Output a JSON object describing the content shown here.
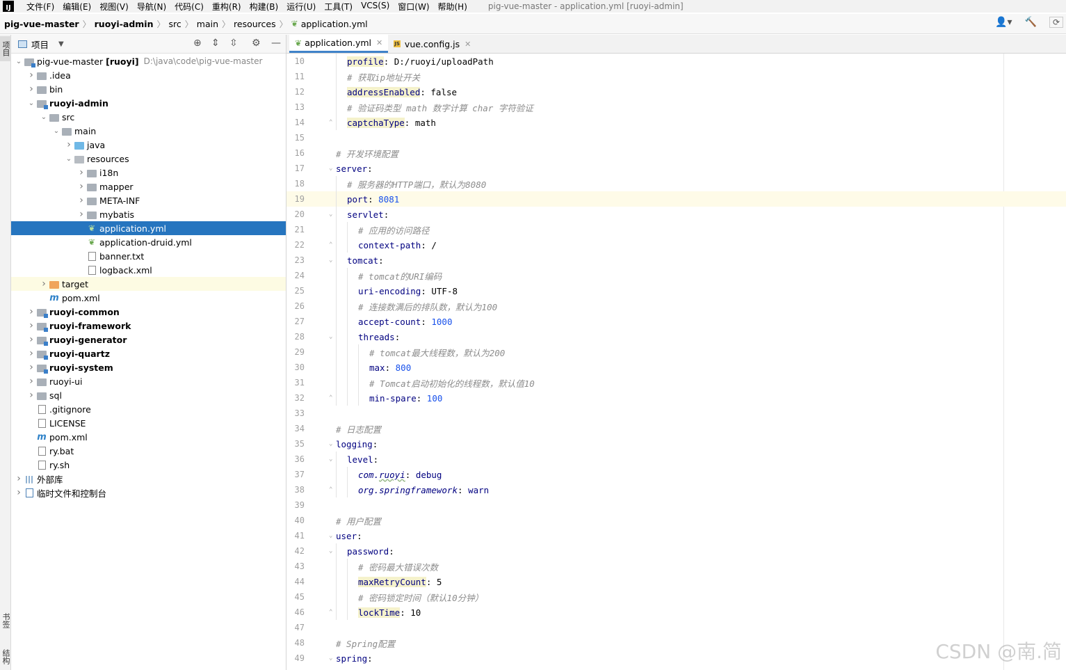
{
  "menubar": {
    "items": [
      "文件(F)",
      "编辑(E)",
      "视图(V)",
      "导航(N)",
      "代码(C)",
      "重构(R)",
      "构建(B)",
      "运行(U)",
      "工具(T)",
      "VCS(S)",
      "窗口(W)",
      "帮助(H)"
    ],
    "window_title": "pig-vue-master - application.yml [ruoyi-admin]"
  },
  "breadcrumb": [
    "pig-vue-master",
    "ruoyi-admin",
    "src",
    "main",
    "resources",
    "application.yml"
  ],
  "strip": {
    "project": "项目",
    "bookmarks": "书签",
    "structure": "结构"
  },
  "project_panel": {
    "title": "项目",
    "tree": [
      {
        "label": "pig-vue-master",
        "bold_suffix": "[ruoyi]",
        "path": "D:\\java\\code\\pig-vue-master",
        "depth": 0,
        "arrow": "open",
        "icon": "module-folder"
      },
      {
        "label": ".idea",
        "depth": 1,
        "arrow": "closed",
        "icon": "folder"
      },
      {
        "label": "bin",
        "depth": 1,
        "arrow": "closed",
        "icon": "folder"
      },
      {
        "label": "ruoyi-admin",
        "depth": 1,
        "arrow": "open",
        "icon": "module-folder",
        "bold": true
      },
      {
        "label": "src",
        "depth": 2,
        "arrow": "open",
        "icon": "folder"
      },
      {
        "label": "main",
        "depth": 3,
        "arrow": "open",
        "icon": "folder"
      },
      {
        "label": "java",
        "depth": 4,
        "arrow": "closed",
        "icon": "folder-blue"
      },
      {
        "label": "resources",
        "depth": 4,
        "arrow": "open",
        "icon": "folder-res"
      },
      {
        "label": "i18n",
        "depth": 5,
        "arrow": "closed",
        "icon": "folder"
      },
      {
        "label": "mapper",
        "depth": 5,
        "arrow": "closed",
        "icon": "folder"
      },
      {
        "label": "META-INF",
        "depth": 5,
        "arrow": "closed",
        "icon": "folder"
      },
      {
        "label": "mybatis",
        "depth": 5,
        "arrow": "closed",
        "icon": "folder"
      },
      {
        "label": "application.yml",
        "depth": 5,
        "arrow": "none",
        "icon": "yml",
        "selected": true
      },
      {
        "label": "application-druid.yml",
        "depth": 5,
        "arrow": "none",
        "icon": "yml"
      },
      {
        "label": "banner.txt",
        "depth": 5,
        "arrow": "none",
        "icon": "doc"
      },
      {
        "label": "logback.xml",
        "depth": 5,
        "arrow": "none",
        "icon": "doc"
      },
      {
        "label": "target",
        "depth": 2,
        "arrow": "closed",
        "icon": "folder-orange",
        "highlight": true
      },
      {
        "label": "pom.xml",
        "depth": 2,
        "arrow": "none",
        "icon": "maven"
      },
      {
        "label": "ruoyi-common",
        "depth": 1,
        "arrow": "closed",
        "icon": "module-folder",
        "bold": true
      },
      {
        "label": "ruoyi-framework",
        "depth": 1,
        "arrow": "closed",
        "icon": "module-folder",
        "bold": true
      },
      {
        "label": "ruoyi-generator",
        "depth": 1,
        "arrow": "closed",
        "icon": "module-folder",
        "bold": true
      },
      {
        "label": "ruoyi-quartz",
        "depth": 1,
        "arrow": "closed",
        "icon": "module-folder",
        "bold": true
      },
      {
        "label": "ruoyi-system",
        "depth": 1,
        "arrow": "closed",
        "icon": "module-folder",
        "bold": true
      },
      {
        "label": "ruoyi-ui",
        "depth": 1,
        "arrow": "closed",
        "icon": "folder"
      },
      {
        "label": "sql",
        "depth": 1,
        "arrow": "closed",
        "icon": "folder"
      },
      {
        "label": ".gitignore",
        "depth": 1,
        "arrow": "none",
        "icon": "doc"
      },
      {
        "label": "LICENSE",
        "depth": 1,
        "arrow": "none",
        "icon": "doc"
      },
      {
        "label": "pom.xml",
        "depth": 1,
        "arrow": "none",
        "icon": "maven"
      },
      {
        "label": "ry.bat",
        "depth": 1,
        "arrow": "none",
        "icon": "doc"
      },
      {
        "label": "ry.sh",
        "depth": 1,
        "arrow": "none",
        "icon": "doc"
      },
      {
        "label": "外部库",
        "depth": 0,
        "arrow": "closed",
        "icon": "library"
      },
      {
        "label": "临时文件和控制台",
        "depth": 0,
        "arrow": "closed",
        "icon": "scratch"
      }
    ]
  },
  "tabs": [
    {
      "label": "application.yml",
      "active": true,
      "icon": "yml"
    },
    {
      "label": "vue.config.js",
      "active": false,
      "icon": "js"
    }
  ],
  "editor": {
    "current_line": 19,
    "lines": [
      {
        "n": "10",
        "indent": 1,
        "parts": [
          [
            "key hl",
            "profile"
          ],
          [
            "val",
            ": D:/ruoyi/uploadPath"
          ]
        ]
      },
      {
        "n": "11",
        "indent": 1,
        "parts": [
          [
            "cmt",
            "# 获取ip地址开关"
          ]
        ]
      },
      {
        "n": "12",
        "indent": 1,
        "parts": [
          [
            "key hl",
            "addressEnabled"
          ],
          [
            "val",
            ": false"
          ]
        ]
      },
      {
        "n": "13",
        "indent": 1,
        "parts": [
          [
            "cmt",
            "# 验证码类型 math 数字计算 char 字符验证"
          ]
        ]
      },
      {
        "n": "14",
        "indent": 1,
        "fold": "end",
        "parts": [
          [
            "key hl",
            "captchaType"
          ],
          [
            "val",
            ": math"
          ]
        ]
      },
      {
        "n": "15",
        "indent": 0,
        "parts": []
      },
      {
        "n": "16",
        "indent": 0,
        "parts": [
          [
            "cmt",
            "# 开发环境配置"
          ]
        ]
      },
      {
        "n": "17",
        "indent": 0,
        "fold": "start",
        "parts": [
          [
            "key",
            "server"
          ],
          [
            "val",
            ":"
          ]
        ]
      },
      {
        "n": "18",
        "indent": 1,
        "parts": [
          [
            "cmt",
            "# 服务器的HTTP端口，默认为8080"
          ]
        ]
      },
      {
        "n": "19",
        "indent": 1,
        "parts": [
          [
            "key",
            "port"
          ],
          [
            "val",
            ": "
          ],
          [
            "num",
            "8081"
          ]
        ]
      },
      {
        "n": "20",
        "indent": 1,
        "fold": "start",
        "parts": [
          [
            "key",
            "servlet"
          ],
          [
            "val",
            ":"
          ]
        ]
      },
      {
        "n": "21",
        "indent": 2,
        "parts": [
          [
            "cmt",
            "# 应用的访问路径"
          ]
        ]
      },
      {
        "n": "22",
        "indent": 2,
        "fold": "end",
        "parts": [
          [
            "key",
            "context-path"
          ],
          [
            "val",
            ": /"
          ]
        ]
      },
      {
        "n": "23",
        "indent": 1,
        "fold": "start",
        "parts": [
          [
            "key",
            "tomcat"
          ],
          [
            "val",
            ":"
          ]
        ]
      },
      {
        "n": "24",
        "indent": 2,
        "parts": [
          [
            "cmt",
            "# tomcat的URI编码"
          ]
        ]
      },
      {
        "n": "25",
        "indent": 2,
        "parts": [
          [
            "key",
            "uri-encoding"
          ],
          [
            "val",
            ": UTF-8"
          ]
        ]
      },
      {
        "n": "26",
        "indent": 2,
        "parts": [
          [
            "cmt",
            "# 连接数满后的排队数，默认为100"
          ]
        ]
      },
      {
        "n": "27",
        "indent": 2,
        "parts": [
          [
            "key",
            "accept-count"
          ],
          [
            "val",
            ": "
          ],
          [
            "num",
            "1000"
          ]
        ]
      },
      {
        "n": "28",
        "indent": 2,
        "fold": "start",
        "parts": [
          [
            "key",
            "threads"
          ],
          [
            "val",
            ":"
          ]
        ]
      },
      {
        "n": "29",
        "indent": 3,
        "parts": [
          [
            "cmt",
            "# tomcat最大线程数，默认为200"
          ]
        ]
      },
      {
        "n": "30",
        "indent": 3,
        "parts": [
          [
            "key",
            "max"
          ],
          [
            "val",
            ": "
          ],
          [
            "num",
            "800"
          ]
        ]
      },
      {
        "n": "31",
        "indent": 3,
        "parts": [
          [
            "cmt",
            "# Tomcat启动初始化的线程数，默认值10"
          ]
        ]
      },
      {
        "n": "32",
        "indent": 3,
        "fold": "end",
        "parts": [
          [
            "key",
            "min-spare"
          ],
          [
            "val",
            ": "
          ],
          [
            "num",
            "100"
          ]
        ]
      },
      {
        "n": "33",
        "indent": 0,
        "parts": []
      },
      {
        "n": "34",
        "indent": 0,
        "parts": [
          [
            "cmt",
            "# 日志配置"
          ]
        ]
      },
      {
        "n": "35",
        "indent": 0,
        "fold": "start",
        "parts": [
          [
            "key",
            "logging"
          ],
          [
            "val",
            ":"
          ]
        ]
      },
      {
        "n": "36",
        "indent": 1,
        "fold": "start",
        "parts": [
          [
            "key",
            "level"
          ],
          [
            "val",
            ":"
          ]
        ]
      },
      {
        "n": "37",
        "indent": 2,
        "parts": [
          [
            "key italic",
            "com."
          ],
          [
            "key italic wavy",
            "ruoyi"
          ],
          [
            "val",
            ": "
          ],
          [
            "key",
            "debug"
          ]
        ]
      },
      {
        "n": "38",
        "indent": 2,
        "fold": "end",
        "parts": [
          [
            "key italic",
            "org.springframework"
          ],
          [
            "val",
            ": "
          ],
          [
            "key",
            "warn"
          ]
        ]
      },
      {
        "n": "39",
        "indent": 0,
        "parts": []
      },
      {
        "n": "40",
        "indent": 0,
        "parts": [
          [
            "cmt",
            "# 用户配置"
          ]
        ]
      },
      {
        "n": "41",
        "indent": 0,
        "fold": "start",
        "parts": [
          [
            "key",
            "user"
          ],
          [
            "val",
            ":"
          ]
        ]
      },
      {
        "n": "42",
        "indent": 1,
        "fold": "start",
        "parts": [
          [
            "key",
            "password"
          ],
          [
            "val",
            ":"
          ]
        ]
      },
      {
        "n": "43",
        "indent": 2,
        "parts": [
          [
            "cmt",
            "# 密码最大错误次数"
          ]
        ]
      },
      {
        "n": "44",
        "indent": 2,
        "parts": [
          [
            "key hl",
            "maxRetryCount"
          ],
          [
            "val",
            ": 5"
          ]
        ]
      },
      {
        "n": "45",
        "indent": 2,
        "parts": [
          [
            "cmt",
            "# 密码锁定时间（默认10分钟）"
          ]
        ]
      },
      {
        "n": "46",
        "indent": 2,
        "fold": "end",
        "parts": [
          [
            "key hl",
            "lockTime"
          ],
          [
            "val",
            ": 10"
          ]
        ]
      },
      {
        "n": "47",
        "indent": 0,
        "parts": []
      },
      {
        "n": "48",
        "indent": 0,
        "parts": [
          [
            "cmt",
            "# Spring配置"
          ]
        ]
      },
      {
        "n": "49",
        "indent": 0,
        "fold": "start",
        "parts": [
          [
            "key",
            "spring"
          ],
          [
            "val",
            ":"
          ]
        ]
      }
    ]
  },
  "watermark": "CSDN @南.简"
}
